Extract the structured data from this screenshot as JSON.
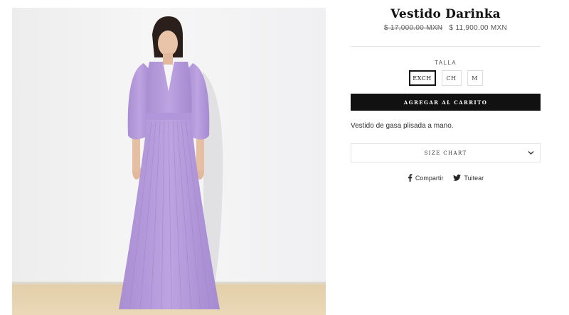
{
  "product": {
    "title": "Vestido Darinka",
    "price_original": "$ 17,000.00 MXN",
    "price_sale": "$ 11,900.00 MXN",
    "description": "Vestido de gasa plisada a mano."
  },
  "size": {
    "label": "TALLA",
    "options": [
      "EXCH",
      "CH",
      "M"
    ],
    "selected": "EXCH"
  },
  "actions": {
    "add_to_cart": "AGREGAR AL CARRITO",
    "size_chart": "SIZE CHART"
  },
  "share": {
    "facebook": "Compartir",
    "twitter": "Tuitear"
  },
  "image": {
    "subject": "model in long pleated lavender dress",
    "dress_color": "#b79ddc"
  },
  "icons": {
    "size_chart_toggle": "chevron-down-icon",
    "facebook": "facebook-icon",
    "twitter": "twitter-icon"
  }
}
